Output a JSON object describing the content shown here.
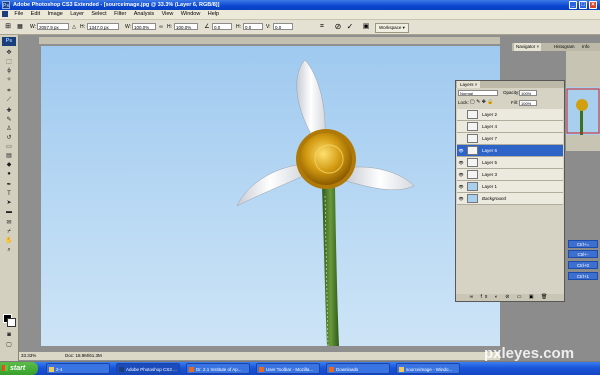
{
  "window": {
    "title": "Adobe Photoshop CS3 Extended - [sourceimage.jpg @ 33.3% (Layer 6, RGB/8)]",
    "controls": {
      "minimize": "_",
      "maximize": "□",
      "close": "×"
    }
  },
  "menu": [
    "File",
    "Edit",
    "Image",
    "Layer",
    "Select",
    "Filter",
    "Analysis",
    "View",
    "Window",
    "Help"
  ],
  "options": {
    "w_label": "W:",
    "w_value": "2057.9 px",
    "h_label": "H:",
    "h_value": "1347.0 px",
    "x_label": "W:",
    "x_value": "100.0%",
    "y_label": "H:",
    "y_value": "100.0%",
    "rot_value": "0.0",
    "h_skew_label": "H:",
    "h_skew_value": "0.0",
    "v_skew_label": "V:",
    "v_skew_value": "0.0",
    "workspace_label": "Workspace ▾"
  },
  "status": {
    "zoom": "33.33%",
    "doc": "Doc: 18.9M/61.3M"
  },
  "layers_panel": {
    "tab": "Layers ×",
    "blend_mode": "Normal",
    "opacity_label": "Opacity:",
    "opacity_value": "100%",
    "lock_label": "Lock:",
    "fill_label": "Fill:",
    "fill_value": "100%",
    "layers": [
      {
        "name": "Layer 2",
        "visible": false,
        "selected": false
      },
      {
        "name": "Layer 4",
        "visible": false,
        "selected": false
      },
      {
        "name": "Layer 7",
        "visible": false,
        "selected": false
      },
      {
        "name": "Layer 6",
        "visible": true,
        "selected": true
      },
      {
        "name": "Layer 5",
        "visible": true,
        "selected": false
      },
      {
        "name": "Layer 3",
        "visible": true,
        "selected": false
      },
      {
        "name": "Layer 1",
        "visible": true,
        "selected": false
      },
      {
        "name": "Background",
        "visible": true,
        "selected": false
      }
    ]
  },
  "dock": {
    "tabs": [
      "Navigator ×",
      "Histogram",
      "Info"
    ],
    "actions": [
      "Ctrl+=",
      "Ctrl+-",
      "Ctrl+0",
      "Ctrl+1"
    ]
  },
  "taskbar": {
    "start": "start",
    "tasks": [
      "2-4",
      "Adobe Photoshop CS3 ...",
      "Dr. 2.1 Institute of Ap...",
      "User Toolbar - Mozilla...",
      "Downloads",
      "sourceimage - Windo..."
    ]
  },
  "watermark": "pxleyes.com",
  "colors": {
    "accent": "#2e63c8",
    "sky": "#b9d9f4",
    "stem": "#4a7a2a",
    "petal": "#f2f2f4",
    "center": "#d8a010"
  }
}
